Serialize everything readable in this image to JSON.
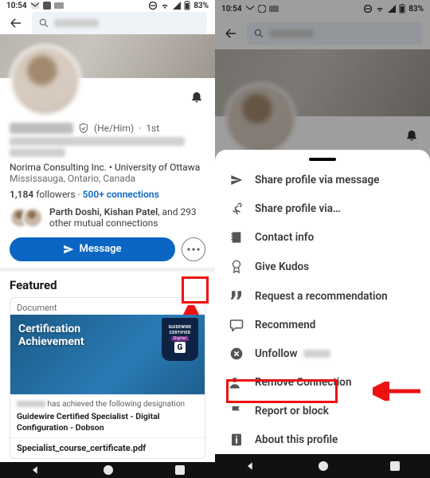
{
  "status": {
    "time": "10:54",
    "battery": "83%"
  },
  "profile": {
    "pronouns": "(He/Him)",
    "degree": "1st",
    "company_line": "Norima Consulting Inc. • University of Ottawa",
    "location": "Mississauga, Ontario, Canada",
    "followers_count": "1,184",
    "followers_label": "followers",
    "connections_label": "500+ connections",
    "mutuals_lead": "Parth Doshi, Kishan Patel",
    "mutuals_tail": ", and 293 other mutual connections",
    "message_label": "Message"
  },
  "featured": {
    "heading": "Featured",
    "card": {
      "type_label": "Document",
      "title_line1": "Certification",
      "title_line2": "Achievement",
      "badge_l1": "GUIDEWIRE",
      "badge_l2": "CERTIFIED",
      "badge_pill": "Digital",
      "desc_small": "has achieved the following designation",
      "desc_bold": "Guidewire Certified Specialist - Digital Configuration - Dobson",
      "filename": "Specialist_course_certificate.pdf"
    }
  },
  "sheet": {
    "items": [
      {
        "icon": "send",
        "label": "Share profile via message"
      },
      {
        "icon": "share",
        "label": "Share profile via…"
      },
      {
        "icon": "contact",
        "label": "Contact info"
      },
      {
        "icon": "kudos",
        "label": "Give Kudos"
      },
      {
        "icon": "quote",
        "label": "Request a recommendation"
      },
      {
        "icon": "recommend",
        "label": "Recommend"
      },
      {
        "icon": "unfollow",
        "label": "Unfollow"
      },
      {
        "icon": "remove",
        "label": "Remove Connection"
      },
      {
        "icon": "flag",
        "label": "Report or block"
      },
      {
        "icon": "info",
        "label": "About this profile"
      }
    ]
  }
}
